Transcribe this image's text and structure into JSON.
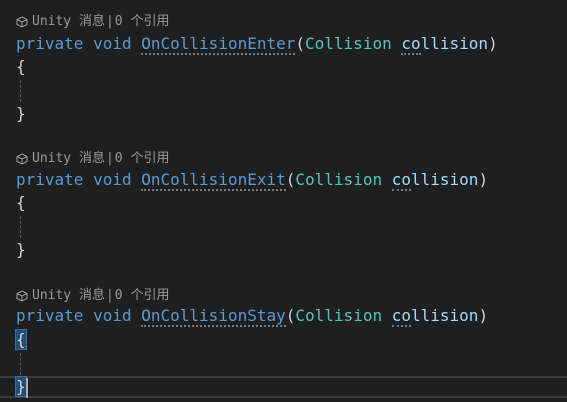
{
  "methods": [
    {
      "codelens": {
        "prefix": "Unity 消息",
        "separator": "|",
        "refs": "0 个引用"
      },
      "signature": {
        "modifier": "private",
        "return_type": "void",
        "name": "OnCollisionEnter",
        "open_paren": "(",
        "param_type": "Collision",
        "param_name_a": "co",
        "param_name_b": "llision",
        "close_paren": ")"
      },
      "open_brace": "{",
      "close_brace": "}"
    },
    {
      "codelens": {
        "prefix": "Unity 消息",
        "separator": "|",
        "refs": "0 个引用"
      },
      "signature": {
        "modifier": "private",
        "return_type": "void",
        "name": "OnCollisionExit",
        "open_paren": "(",
        "param_type": "Collision",
        "param_name_a": "co",
        "param_name_b": "llision",
        "close_paren": ")"
      },
      "open_brace": "{",
      "close_brace": "}"
    },
    {
      "codelens": {
        "prefix": "Unity 消息",
        "separator": "|",
        "refs": "0 个引用"
      },
      "signature": {
        "modifier": "private",
        "return_type": "void",
        "name": "OnCollisionStay",
        "open_paren": "(",
        "param_type": "Collision",
        "param_name_a": "co",
        "param_name_b": "llision",
        "close_paren": ")"
      },
      "open_brace": "{",
      "close_brace": "}"
    }
  ],
  "colors": {
    "background": "#1f1f1f",
    "keyword": "#569cd6",
    "type": "#4ec9b0",
    "parameter": "#9cdcfe",
    "codelens": "#999999"
  },
  "icons": {
    "codelens_icon": "unity-cube-icon"
  }
}
